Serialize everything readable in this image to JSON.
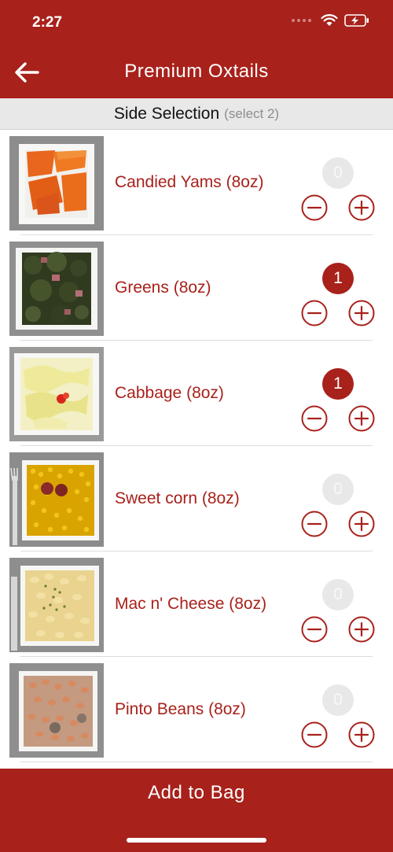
{
  "status": {
    "time": "2:27"
  },
  "header": {
    "title": "Premium Oxtails"
  },
  "section": {
    "title": "Side Selection",
    "hint": "(select 2)"
  },
  "items": [
    {
      "name": "Candied Yams (8oz)",
      "qty": "0"
    },
    {
      "name": "Greens (8oz)",
      "qty": "1"
    },
    {
      "name": "Cabbage (8oz)",
      "qty": "1"
    },
    {
      "name": "Sweet corn (8oz)",
      "qty": "0"
    },
    {
      "name": "Mac n' Cheese (8oz)",
      "qty": "0"
    },
    {
      "name": "Pinto Beans (8oz)",
      "qty": "0"
    }
  ],
  "footer": {
    "add_label": "Add to Bag"
  },
  "colors": {
    "accent": "#a8211b",
    "inactive_badge": "#e8e8e8",
    "section_bg": "#e8e8e8"
  },
  "icons": [
    "back-arrow-icon",
    "wifi-icon",
    "battery-charging-icon",
    "minus-circle-icon",
    "plus-circle-icon"
  ]
}
